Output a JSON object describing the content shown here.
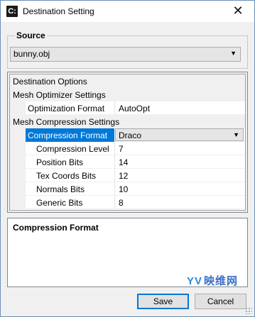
{
  "window": {
    "title": "Destination Setting",
    "app_icon_glyph": "C:"
  },
  "source": {
    "label": "Source",
    "value": "bunny.obj"
  },
  "properties": {
    "destination_options": "Destination Options",
    "mesh_optimizer": {
      "label": "Mesh Optimizer Settings",
      "optimization_format": {
        "label": "Optimization Format",
        "value": "AutoOpt"
      }
    },
    "mesh_compression": {
      "label": "Mesh Compression Settings",
      "compression_format": {
        "label": "Compression Format",
        "value": "Draco"
      },
      "compression_level": {
        "label": "Compression Level",
        "value": "7"
      },
      "position_bits": {
        "label": "Position Bits",
        "value": "14"
      },
      "tex_coords_bits": {
        "label": "Tex Coords Bits",
        "value": "12"
      },
      "normals_bits": {
        "label": "Normals Bits",
        "value": "10"
      },
      "generic_bits": {
        "label": "Generic Bits",
        "value": "8"
      }
    }
  },
  "description": {
    "title": "Compression Format"
  },
  "watermark": {
    "text": "映维网",
    "logo": "YV"
  },
  "buttons": {
    "save": "Save",
    "cancel": "Cancel"
  },
  "colors": {
    "selection": "#0078d7",
    "title_border": "#6e8fb7"
  }
}
